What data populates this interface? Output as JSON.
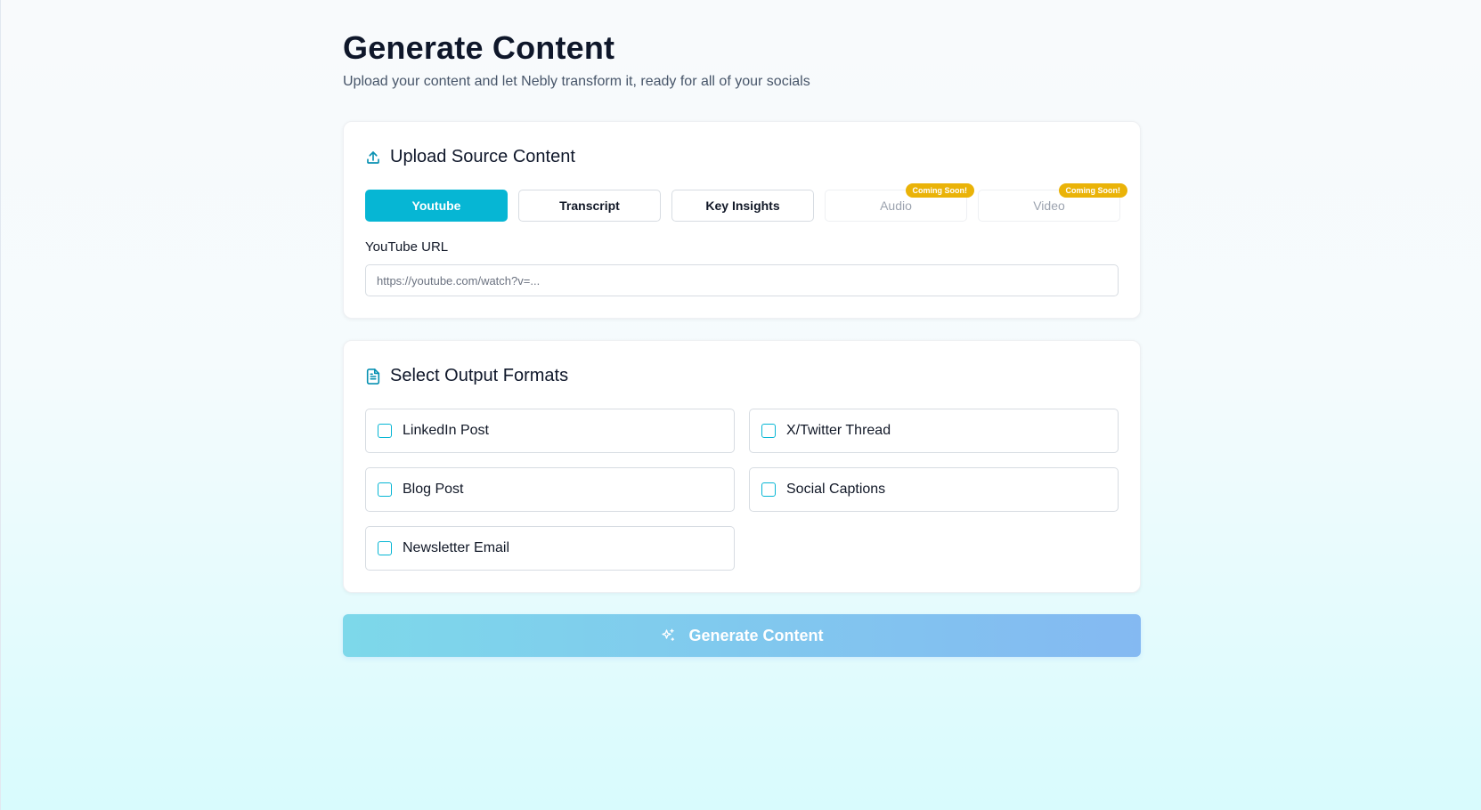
{
  "header": {
    "title": "Generate Content",
    "subtitle": "Upload your content and let Nebly transform it, ready for all of your socials"
  },
  "upload": {
    "title": "Upload Source Content",
    "icon": "upload-icon",
    "tabs": [
      {
        "label": "Youtube",
        "active": true
      },
      {
        "label": "Transcript"
      },
      {
        "label": "Key Insights"
      },
      {
        "label": "Audio",
        "disabled": true,
        "badge": "Coming Soon!"
      },
      {
        "label": "Video",
        "disabled": true,
        "badge": "Coming Soon!"
      }
    ],
    "url_label": "YouTube URL",
    "url_placeholder": "https://youtube.com/watch?v=...",
    "url_value": ""
  },
  "formats": {
    "title": "Select Output Formats",
    "icon": "document-icon",
    "options": [
      {
        "label": "LinkedIn Post",
        "checked": false
      },
      {
        "label": "X/Twitter Thread",
        "checked": false
      },
      {
        "label": "Blog Post",
        "checked": false
      },
      {
        "label": "Social Captions",
        "checked": false
      },
      {
        "label": "Newsletter Email",
        "checked": false
      }
    ]
  },
  "generate": {
    "label": "Generate Content",
    "icon": "sparkles-icon"
  },
  "colors": {
    "accent": "#06b6d4",
    "badge": "#eab308",
    "button_gradient_start": "#7dd8ea",
    "button_gradient_end": "#84b9f2"
  }
}
